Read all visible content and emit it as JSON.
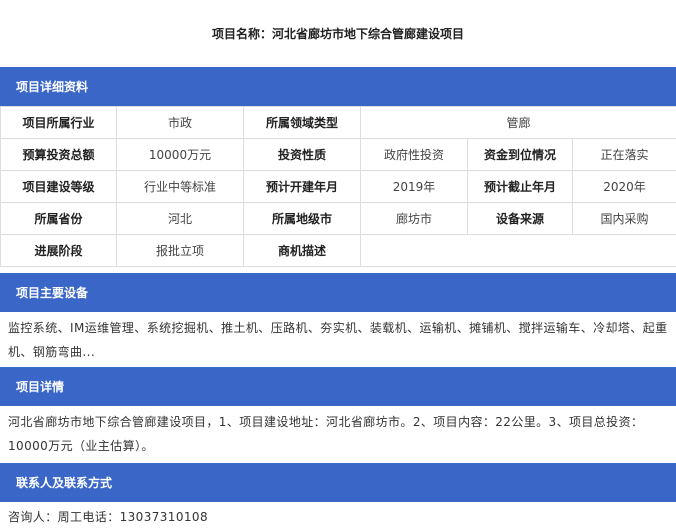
{
  "page_title": "项目名称：河北省廊坊市地下综合管廊建设项目",
  "sections": {
    "details_header": "项目详细资料",
    "equipment_header": "项目主要设备",
    "project_detail_header": "项目详情",
    "contact_header": "联系人及联系方式"
  },
  "details": {
    "r1": {
      "l1": "项目所属行业",
      "v1": "市政",
      "l2": "所属领域类型",
      "v2": "管廊"
    },
    "r2": {
      "l1": "预算投资总额",
      "v1": "10000万元",
      "l2": "投资性质",
      "v2": "政府性投资",
      "l3": "资金到位情况",
      "v3": "正在落实"
    },
    "r3": {
      "l1": "项目建设等级",
      "v1": "行业中等标准",
      "l2": "预计开建年月",
      "v2": "2019年",
      "l3": "预计截止年月",
      "v3": "2020年"
    },
    "r4": {
      "l1": "所属省份",
      "v1": "河北",
      "l2": "所属地级市",
      "v2": "廊坊市",
      "l3": "设备来源",
      "v3": "国内采购"
    },
    "r5": {
      "l1": "进展阶段",
      "v1": "报批立项",
      "l2": "商机描述",
      "v2": ""
    }
  },
  "equipment_text": "监控系统、IM运维管理、系统挖掘机、推土机、压路机、夯实机、装载机、运输机、摊铺机、搅拌运输车、冷却塔、起重机、钢筋弯曲...",
  "project_detail_text": "河北省廊坊市地下综合管廊建设项目，1、项目建设地址：河北省廊坊市。2、项目内容：22公里。3、项目总投资：10000万元（业主估算）。",
  "contact_text": "咨询人：周工电话：13037310108",
  "colors": {
    "section_bar": "#3a66c8",
    "border": "#dedede"
  }
}
